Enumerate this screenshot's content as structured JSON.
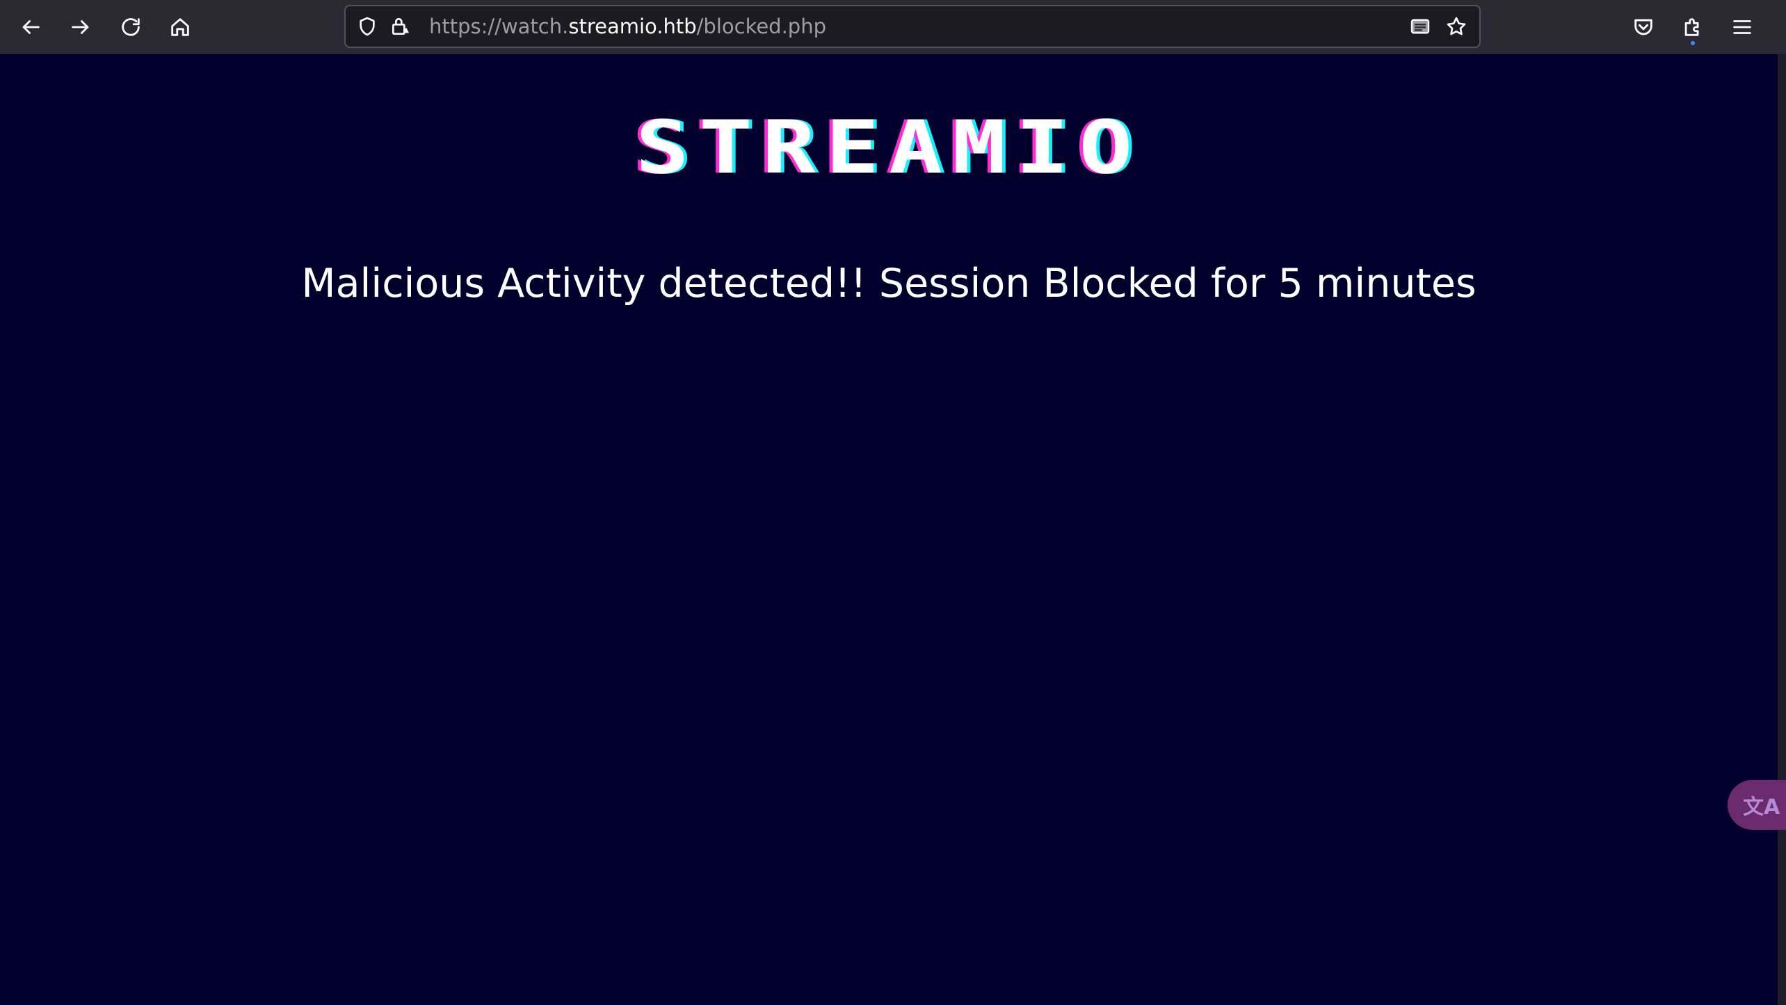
{
  "browser": {
    "url_prefix": "https://watch.",
    "url_host": "streamio.htb",
    "url_path": "/blocked.php",
    "icons": {
      "back": "back-arrow-icon",
      "forward": "forward-arrow-icon",
      "reload": "reload-icon",
      "home": "home-icon",
      "shield": "shield-icon",
      "lock": "lock-warning-icon",
      "reader": "reader-view-icon",
      "bookmark": "star-icon",
      "pocket": "pocket-icon",
      "extensions": "extensions-icon",
      "menu": "hamburger-menu-icon"
    }
  },
  "page": {
    "logo_text": "STREAMIO",
    "message": "Malicious Activity detected!! Session Blocked for 5 minutes"
  },
  "translate_widget": {
    "label": "文A"
  },
  "colors": {
    "page_background": "#01002c",
    "toolbar_background": "#2b2a33",
    "logo_magenta": "#ff2bd6",
    "logo_cyan": "#18f0ff"
  }
}
